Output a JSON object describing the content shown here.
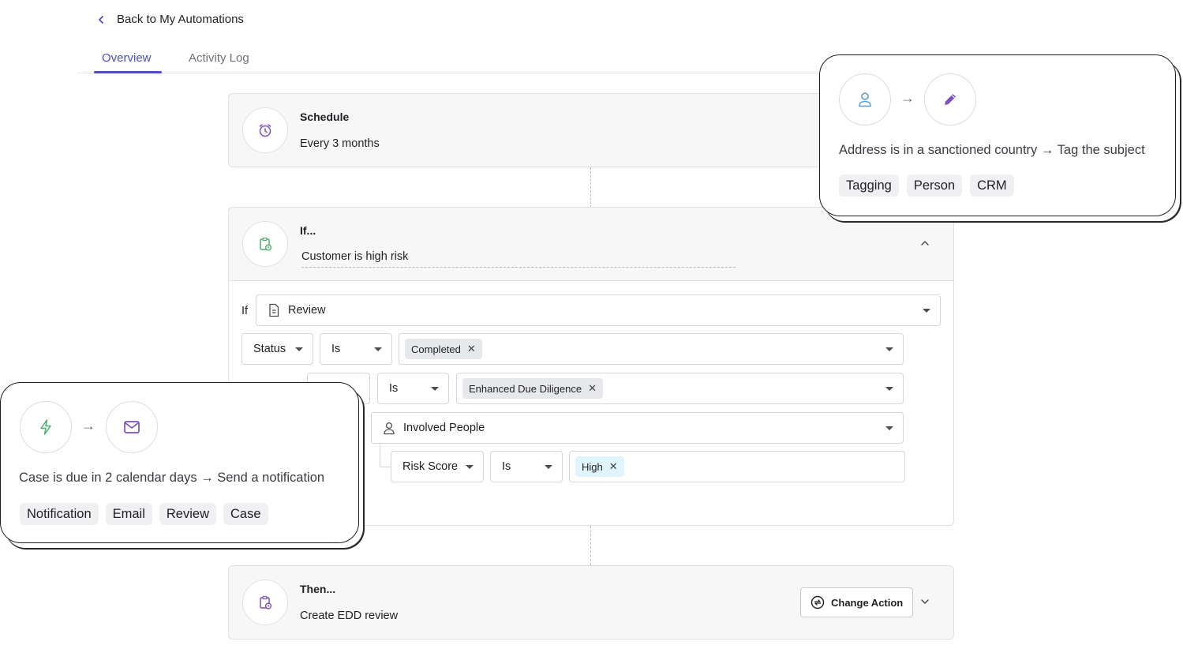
{
  "nav": {
    "back_label": "Back to My Automations"
  },
  "tabs": [
    {
      "label": "Overview",
      "active": true
    },
    {
      "label": "Activity Log",
      "active": false
    }
  ],
  "schedule": {
    "title": "Schedule",
    "value": "Every 3 months",
    "icon": "alarm-clock-icon"
  },
  "condition": {
    "title": "If...",
    "name": "Customer is high risk",
    "if_label": "If",
    "entity": "Review",
    "rows": [
      {
        "field": "Status",
        "operator": "Is",
        "values": [
          "Completed"
        ]
      },
      {
        "operator": "Is",
        "values": [
          "Enhanced Due Diligence"
        ]
      },
      {
        "entity": "Involved People"
      },
      {
        "field": "Risk Score",
        "operator": "Is",
        "values": [
          "High"
        ]
      }
    ]
  },
  "action": {
    "title": "Then...",
    "value": "Create EDD review",
    "button": "Change Action",
    "icon": "clipboard-clock-icon"
  },
  "popup_right": {
    "text": "Address is in a sanctioned country → Tag the subject",
    "tags": [
      "Tagging",
      "Person",
      "CRM"
    ],
    "from_icon": "person-icon",
    "to_icon": "pencil-icon"
  },
  "popup_left": {
    "text": "Case is due in 2 calendar days → Send a notification",
    "tags": [
      "Notification",
      "Email",
      "Review",
      "Case"
    ],
    "from_icon": "lightning-icon",
    "to_icon": "envelope-icon"
  },
  "arrow_glyph": "→",
  "colors": {
    "accent": "#4b4fc2",
    "purple_icon": "#7b4fc0",
    "green_icon": "#4caf6e",
    "blue_icon": "#5a9fd6",
    "chip_blue": "#dff4fb"
  }
}
